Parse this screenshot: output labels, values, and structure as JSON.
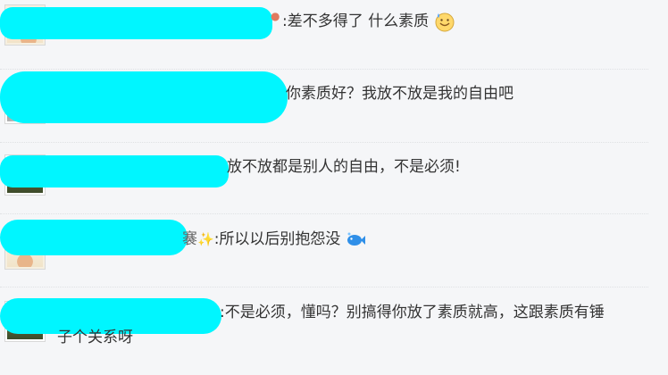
{
  "comments": [
    {
      "text": ":差不多得了 什么素质",
      "emoji": "sweat-smile-face-icon"
    },
    {
      "text": "你素质好？我放不放是我的自由吧"
    },
    {
      "text": "放不放都是别人的自由，不是必须!"
    },
    {
      "name_tail": "褰",
      "text": ":所以以后别抱怨没",
      "emoji": "fish-icon"
    },
    {
      "name_tail": "",
      "text": ":不是必须，懂吗？别搞得你放了素质就高，这跟素质有锤",
      "text_line2": "子个关系呀"
    }
  ],
  "colors": {
    "redaction": "#00f6ff",
    "background": "#f5f6f8"
  }
}
